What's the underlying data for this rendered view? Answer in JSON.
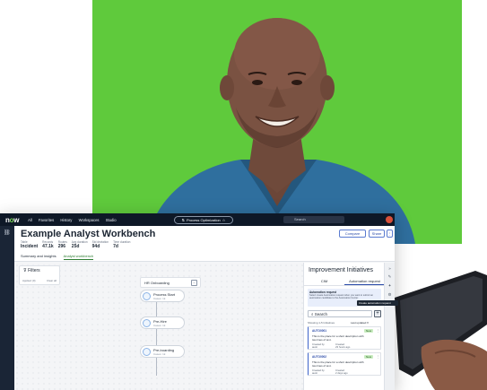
{
  "topbar": {
    "logo": "now",
    "nav": [
      "All",
      "Favorites",
      "History",
      "Workspaces",
      "Studio"
    ],
    "workspace_pill": "Process Optimization",
    "search_placeholder": "Search"
  },
  "header": {
    "title": "Example Analyst Workbench",
    "stats": [
      {
        "label": "Table",
        "value": "Incident"
      },
      {
        "label": "Records",
        "value": "47.1k"
      },
      {
        "label": "Routes",
        "value": "296"
      },
      {
        "label": "Avg duration",
        "value": "25d"
      },
      {
        "label": "Std deviation",
        "value": "94d"
      },
      {
        "label": "Time duration",
        "value": "7d"
      }
    ],
    "compare_label": "Compare",
    "share_label": "Share",
    "tabs": [
      {
        "label": "Summary and insights",
        "active": false
      },
      {
        "label": "Analyst workbench",
        "active": true
      }
    ]
  },
  "filters": {
    "label": "Filters",
    "applied": "Applied (0)",
    "clear": "Clear all"
  },
  "graph": {
    "group_label": "HR Onboarding",
    "nodes": [
      {
        "name": "Process Start",
        "sub": "Cases: 1k"
      },
      {
        "name": "Pre-Hire",
        "sub": "Cases: 1k"
      },
      {
        "name": "Pre-boarding",
        "sub": "Cases: 1k"
      }
    ]
  },
  "panel": {
    "title": "Improvement Initiatives",
    "tabs": [
      "CIM",
      "Automation request"
    ],
    "notice_title": "Automation request",
    "notice_text": "Select create Automation request when you want to submit an automation candidate to the Automation Center.",
    "search_placeholder": "Search",
    "tooltip": "Create automation request",
    "showing": "Showing 1-5 Initiatives",
    "sort": "Last updated",
    "cards": [
      {
        "id": "AUTO0001",
        "badge": "New",
        "desc": "This is the place for a short description with two lines of text.",
        "created_by_label": "Created by",
        "created_by": "austi",
        "created_label": "Created",
        "created": "23 hours ago"
      },
      {
        "id": "AUTO0002",
        "badge": "New",
        "desc": "This is the place for a short description with two lines of text.",
        "created_by_label": "Created by",
        "created_by": "austi",
        "created_label": "Created",
        "created": "2 days ago"
      }
    ]
  },
  "colors": {
    "green_screen": "#5fca3c",
    "topbar": "#0e1827",
    "accent_blue": "#2a4aa8",
    "active_tab_green": "#2e7d32"
  }
}
